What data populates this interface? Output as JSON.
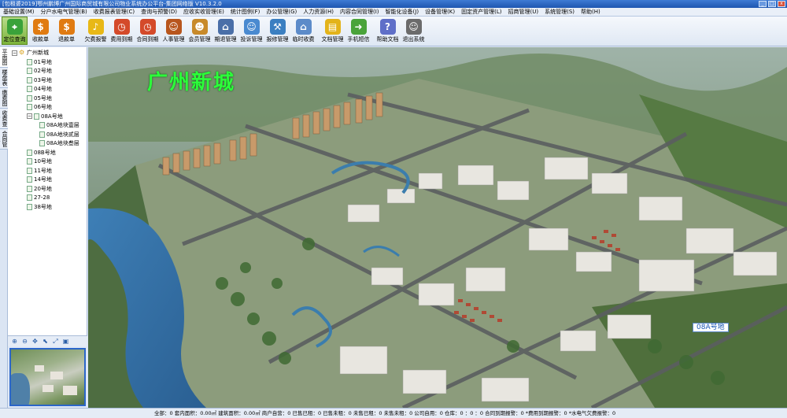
{
  "window": {
    "title": "[包租婆2019]鄂州鹏博广州国际商贸城有限公司物业系统办公平台-集团网络版 V10.3.2.0"
  },
  "menu": [
    "基础设置(M)",
    "分户水电气管理(B)",
    "收费报表管理(C)",
    "查询与预警(D)",
    "应收实收管理(E)",
    "统计图例(F)",
    "办公管理(G)",
    "人力资源(H)",
    "内容合同管理(I)",
    "智能化设备(J)",
    "设备管理(K)",
    "固定资产管理(L)",
    "招商管理(U)",
    "系统管理(S)",
    "帮助(H)"
  ],
  "toolbar": [
    {
      "label": "定位查询",
      "icon": "location-pin-icon",
      "color": "#3aa23a"
    },
    {
      "label": "收款单",
      "icon": "dollar-coin-icon",
      "color": "#e07b12"
    },
    {
      "label": "退款单",
      "icon": "refund-coin-icon",
      "color": "#e07b12"
    },
    {
      "label": "欠费报警",
      "icon": "bell-icon",
      "color": "#e8b816"
    },
    {
      "label": "费用到期",
      "icon": "clock-icon",
      "color": "#d44a2a"
    },
    {
      "label": "合同到期",
      "icon": "contract-clock-icon",
      "color": "#d44a2a"
    },
    {
      "label": "人事管理",
      "icon": "person-icon",
      "color": "#b8561d"
    },
    {
      "label": "会员管理",
      "icon": "members-icon",
      "color": "#c88a2a"
    },
    {
      "label": "期退管理",
      "icon": "desk-lamp-icon",
      "color": "#4a6fa8"
    },
    {
      "label": "投诉管理",
      "icon": "complaint-people-icon",
      "color": "#4a8ad0"
    },
    {
      "label": "报修管理",
      "icon": "repair-tools-icon",
      "color": "#3b7fc1"
    },
    {
      "label": "临时收费",
      "icon": "store-icon",
      "color": "#5c8bc9"
    },
    {
      "label": "文档管理",
      "icon": "folder-icon",
      "color": "#e3b31a"
    },
    {
      "label": "手机短信",
      "icon": "sms-arrow-icon",
      "color": "#4aa33a"
    },
    {
      "label": "帮助文档",
      "icon": "help-book-icon",
      "color": "#5f6fc8"
    },
    {
      "label": "退出系统",
      "icon": "exit-people-icon",
      "color": "#6b6b6b"
    }
  ],
  "side_tabs": [
    "平面图",
    "楼盘表",
    "缴费图",
    "收费查询",
    "合同管理"
  ],
  "tree": {
    "root": "广州新城",
    "items": [
      {
        "label": "01号地",
        "level": 1
      },
      {
        "label": "02号地",
        "level": 1
      },
      {
        "label": "03号地",
        "level": 1
      },
      {
        "label": "04号地",
        "level": 1
      },
      {
        "label": "05号地",
        "level": 1
      },
      {
        "label": "06号地",
        "level": 1
      },
      {
        "label": "08A号地",
        "level": 1,
        "expanded": true
      },
      {
        "label": "08A地块壹层",
        "level": 2
      },
      {
        "label": "08A地块贰层",
        "level": 2
      },
      {
        "label": "08A地块叁层",
        "level": 2
      },
      {
        "label": "08B号地",
        "level": 1
      },
      {
        "label": "10号地",
        "level": 1
      },
      {
        "label": "11号地",
        "level": 1
      },
      {
        "label": "14号地",
        "level": 1
      },
      {
        "label": "20号地",
        "level": 1
      },
      {
        "label": "27-28",
        "level": 1
      },
      {
        "label": "38号地",
        "level": 1
      }
    ]
  },
  "map": {
    "title": "广州新城",
    "plot_label": "08A号地"
  },
  "status": "全部：0    套内面积：0.00㎡    建筑面积：0.00㎡    商户自营：0    已售已租：0    已售未租：0    未售已租：0    未售未租：0    公司自用：0    仓库：0    ：0    ：0    合同到期报警：0    *费用到期报警：0    *水电气欠费报警：0"
}
